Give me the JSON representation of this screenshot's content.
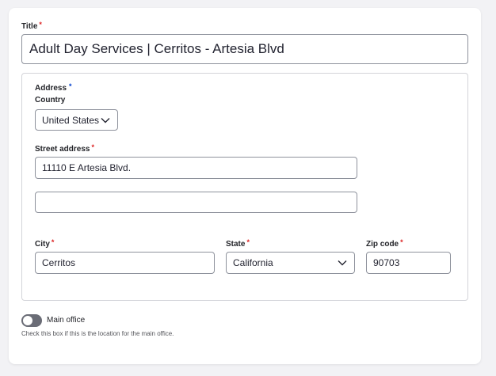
{
  "form": {
    "title_label": "Title",
    "title_required": "*",
    "title_value": "Adult Day Services | Cerritos - Artesia Blvd"
  },
  "address": {
    "legend": "Address",
    "legend_required": "*",
    "country_label": "Country",
    "country_value": "United States",
    "street_label": "Street address",
    "street_required": "*",
    "street1_value": "11110 E Artesia Blvd.",
    "street2_value": "",
    "city_label": "City",
    "city_required": "*",
    "city_value": "Cerritos",
    "state_label": "State",
    "state_required": "*",
    "state_value": "California",
    "zip_label": "Zip code",
    "zip_required": "*",
    "zip_value": "90703"
  },
  "main_office": {
    "label": "Main office",
    "help": "Check this box if this is the location for the main office.",
    "checked": false
  },
  "colors": {
    "background": "#f2f2f5",
    "card": "#ffffff",
    "border": "#8e929c",
    "required": "#dc2323",
    "toggle_off": "#6a6c76"
  },
  "icons": {
    "select_chevron": "chevron-down-icon"
  }
}
